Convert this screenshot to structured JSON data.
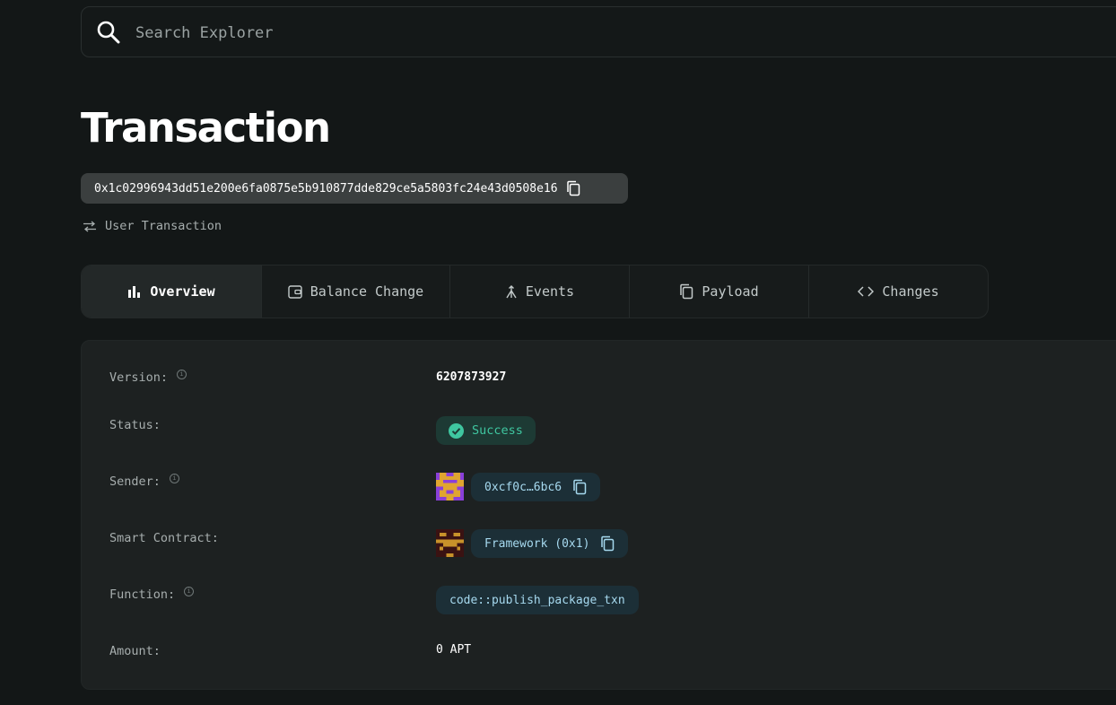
{
  "search": {
    "placeholder": "Search Explorer"
  },
  "page": {
    "title": "Transaction"
  },
  "transaction": {
    "hash": "0x1c02996943dd51e200e6fa0875e5b910877dde829ce5a5803fc24e43d0508e16",
    "type": "User Transaction"
  },
  "tabs": [
    {
      "label": "Overview",
      "icon": "bar-chart-icon",
      "active": true
    },
    {
      "label": "Balance Change",
      "icon": "wallet-icon"
    },
    {
      "label": "Events",
      "icon": "merge-icon"
    },
    {
      "label": "Payload",
      "icon": "copy-icon"
    },
    {
      "label": "Changes",
      "icon": "code-icon"
    }
  ],
  "overview": {
    "version": {
      "label": "Version:",
      "value": "6207873927"
    },
    "status": {
      "label": "Status:",
      "value": "Success"
    },
    "sender": {
      "label": "Sender:",
      "value": "0xcf0c…6bc6"
    },
    "smart_contract": {
      "label": "Smart Contract:",
      "value": "Framework (0x1)"
    },
    "function": {
      "label": "Function:",
      "value": "code::publish_package_txn"
    },
    "amount": {
      "label": "Amount:",
      "value": "0 APT"
    }
  },
  "colors": {
    "background": "#131717",
    "card": "#1d2121",
    "success_bg": "#1d3a34",
    "success_text": "#3fc6a0",
    "pill_bg": "#1c2f37",
    "pill_text": "#a6d9ef"
  }
}
